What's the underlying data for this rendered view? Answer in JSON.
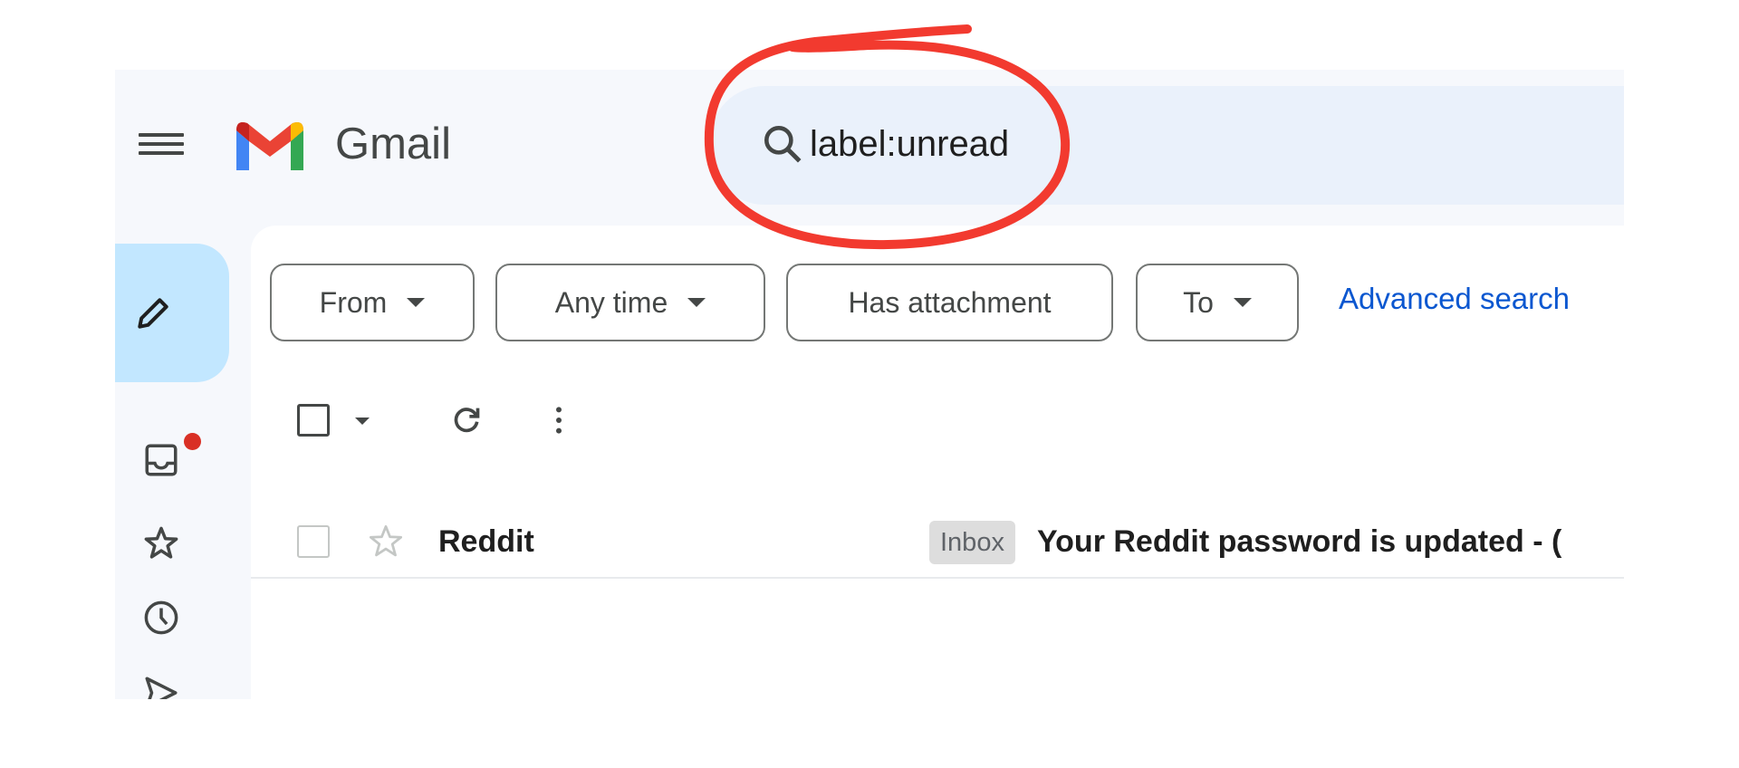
{
  "header": {
    "brand": "Gmail",
    "search_value": "label:unread"
  },
  "filters": {
    "chips": [
      {
        "label": "From",
        "dropdown": true
      },
      {
        "label": "Any time",
        "dropdown": true
      },
      {
        "label": "Has attachment",
        "dropdown": false
      },
      {
        "label": "To",
        "dropdown": true
      }
    ],
    "advanced_search": "Advanced search"
  },
  "sidebar": {
    "icons": [
      "pencil-icon",
      "inbox-icon",
      "star-icon",
      "clock-icon",
      "send-icon"
    ],
    "inbox_badge_color": "#d93025"
  },
  "messages": [
    {
      "sender": "Reddit",
      "label": "Inbox",
      "subject": "Your Reddit password is updated - ("
    }
  ],
  "annotation": {
    "color": "#f23a2f",
    "shape": "ellipse around search query"
  }
}
